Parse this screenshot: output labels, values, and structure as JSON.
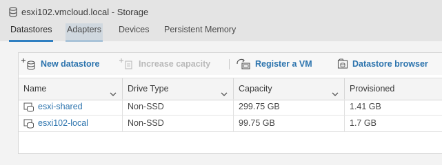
{
  "window": {
    "title": "esxi102.vmcloud.local - Storage"
  },
  "tabs": [
    {
      "label": "Datastores",
      "state": "active"
    },
    {
      "label": "Adapters",
      "state": "hover"
    },
    {
      "label": "Devices",
      "state": "normal"
    },
    {
      "label": "Persistent Memory",
      "state": "normal"
    }
  ],
  "toolbar": {
    "new_datastore": "New datastore",
    "increase_capacity": "Increase capacity",
    "register_vm": "Register a VM",
    "datastore_browser": "Datastore browser"
  },
  "table": {
    "columns": [
      "Name",
      "Drive Type",
      "Capacity",
      "Provisioned"
    ],
    "rows": [
      {
        "name": "esxi-shared",
        "drive_type": "Non-SSD",
        "capacity": "299.75 GB",
        "provisioned": "1.41 GB"
      },
      {
        "name": "esxi102-local",
        "drive_type": "Non-SSD",
        "capacity": "99.75 GB",
        "provisioned": "1.7 GB"
      }
    ]
  },
  "colors": {
    "accent": "#2f7fc1",
    "link": "#2b73ad",
    "disabled": "#b9b9b9"
  }
}
